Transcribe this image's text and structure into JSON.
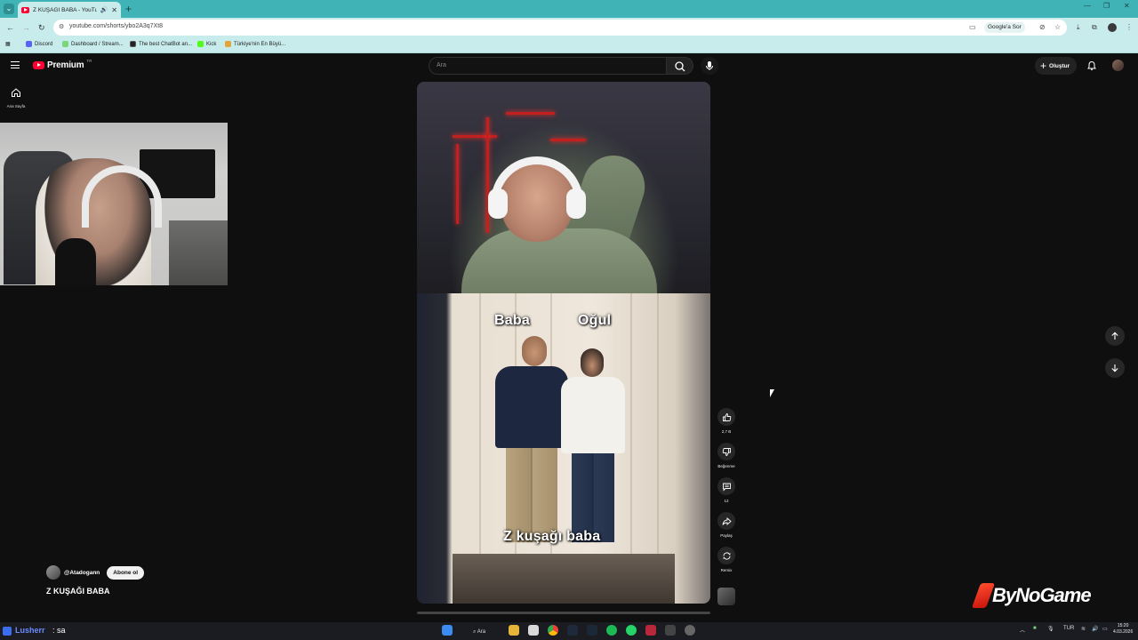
{
  "browser": {
    "tab_title": "Z KUŞAĞI BABA - YouTube",
    "url": "youtube.com/shorts/ybo2A3q7Xt8",
    "ask_google": "Google'a Sor",
    "bookmarks": [
      {
        "label": "Discord",
        "color": "#5865f2"
      },
      {
        "label": "Dashboard / Stream...",
        "color": "#7bd57d"
      },
      {
        "label": "The best ChatBot an...",
        "color": "#222222"
      },
      {
        "label": "Kick",
        "color": "#53fc18"
      },
      {
        "label": "Türkiye'nin En Büyü...",
        "color": "#e2a53b"
      }
    ]
  },
  "header": {
    "brand": "Premium",
    "region": "TR",
    "search_placeholder": "Ara",
    "create_label": "Oluştur"
  },
  "sidebar": {
    "home_label": "Ana Sayfa"
  },
  "short": {
    "overlay_left": "Baba",
    "overlay_right": "Oğul",
    "caption": "Z kuşağı baba",
    "channel": "@Atadogann",
    "subscribe_label": "Abone ol",
    "title": "Z KUŞAĞI BABA"
  },
  "actions": {
    "likes": "2,7 B",
    "dislike_label": "Beğenme",
    "comments": "12",
    "share_label": "Paylaş",
    "remix_label": "Remix"
  },
  "watermark": "ByNoGame",
  "chat": {
    "user": "Lusherr",
    "message": ": sa"
  },
  "taskbar": {
    "search_label": "Ara",
    "language": "TUR",
    "time": "15:20",
    "date": "4.03.2026"
  },
  "colors": {
    "accent_red": "#ff0033",
    "chrome_teal": "#3fb3b6",
    "chrome_light": "#c8ecec",
    "page_bg": "#0f0f0f"
  }
}
